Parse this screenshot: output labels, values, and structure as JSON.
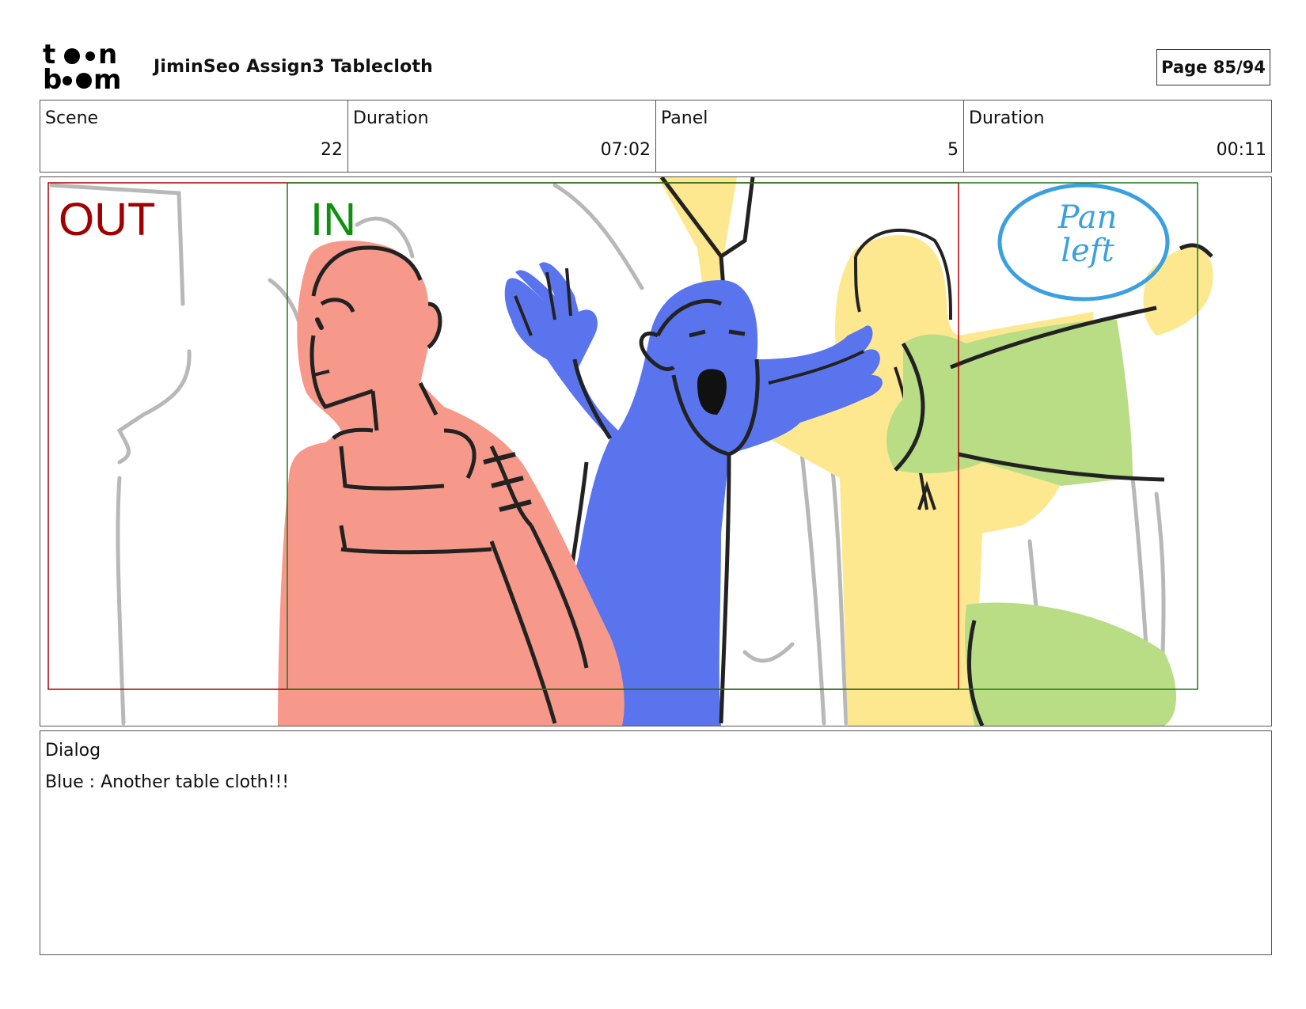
{
  "header": {
    "logo_text": "toon boom",
    "title": "JiminSeo Assign3 Tablecloth",
    "page": "Page 85/94"
  },
  "info": {
    "scene_label": "Scene",
    "scene_value": "22",
    "scene_duration_label": "Duration",
    "scene_duration_value": "07:02",
    "panel_label": "Panel",
    "panel_value": "5",
    "panel_duration_label": "Duration",
    "panel_duration_value": "00:11"
  },
  "frame": {
    "out_label": "OUT",
    "in_label": "IN",
    "pan_note": "Pan left",
    "colors": {
      "out_border": "#b00000",
      "in_border": "#1a7a1a",
      "red_character": "#f6988a",
      "blue_character": "#5a74ee",
      "yellow_character": "#fde890",
      "green_character": "#b9dd85",
      "pan_note": "#3aa0e0"
    }
  },
  "dialog": {
    "label": "Dialog",
    "text": "Blue : Another table cloth!!!"
  }
}
